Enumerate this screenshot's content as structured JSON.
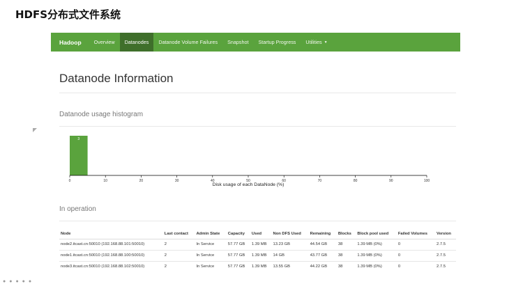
{
  "slide": {
    "title": "HDFS分布式文件系统"
  },
  "navbar": {
    "brand": "Hadoop",
    "items": [
      "Overview",
      "Datanodes",
      "Datanode Volume Failures",
      "Snapshot",
      "Startup Progress",
      "Utilities"
    ],
    "active": "Datanodes",
    "dropdown_icon": "caret-down-icon"
  },
  "page": {
    "title": "Datanode Information",
    "histogram_heading": "Datanode usage histogram",
    "operation_heading": "In operation"
  },
  "chart_data": {
    "type": "bar",
    "title": "",
    "xlabel": "Disk usage of each DataNode (%)",
    "ylabel": "",
    "xlim": [
      0,
      100
    ],
    "x_ticks": [
      0,
      10,
      20,
      30,
      40,
      50,
      60,
      70,
      80,
      90,
      100
    ],
    "bins": [
      {
        "x0": 0,
        "x1": 5,
        "count": 3
      }
    ],
    "bar_color": "#5aa33d",
    "grid": false
  },
  "table": {
    "columns": [
      "Node",
      "Last contact",
      "Admin State",
      "Capacity",
      "Used",
      "Non DFS Used",
      "Remaining",
      "Blocks",
      "Block pool used",
      "Failed Volumes",
      "Version"
    ],
    "rows": [
      [
        "node2.itcast.cn:50010 (192.168.88.101:50010)",
        "2",
        "In Service",
        "57.77 GB",
        "1.39 MB",
        "13.23 GB",
        "44.54 GB",
        "38",
        "1.39 MB (0%)",
        "0",
        "2.7.5"
      ],
      [
        "node1.itcast.cn:50010 (192.168.88.100:50010)",
        "2",
        "In Service",
        "57.77 GB",
        "1.39 MB",
        "14 GB",
        "43.77 GB",
        "38",
        "1.39 MB (0%)",
        "0",
        "2.7.5"
      ],
      [
        "node3.itcast.cn:50010 (192.168.88.102:50010)",
        "2",
        "In Service",
        "57.77 GB",
        "1.39 MB",
        "13.55 GB",
        "44.22 GB",
        "38",
        "1.39 MB (0%)",
        "0",
        "2.7.5"
      ]
    ]
  }
}
